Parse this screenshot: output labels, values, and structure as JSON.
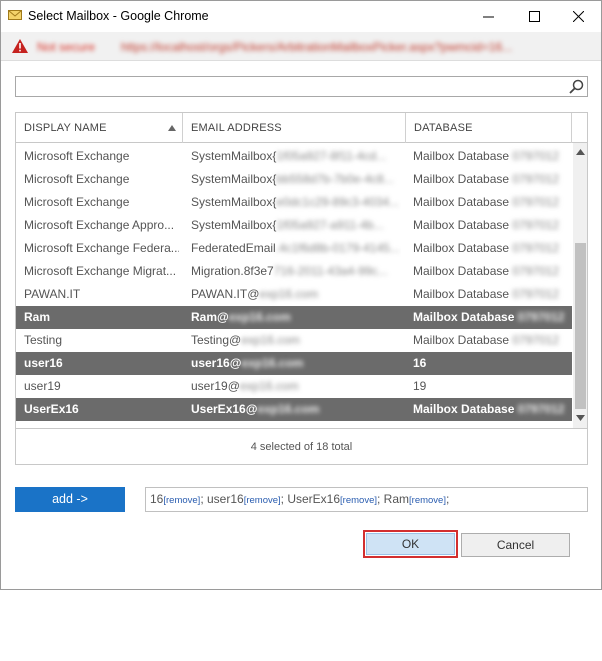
{
  "window": {
    "title": "Select Mailbox - Google Chrome"
  },
  "urlbar": {
    "security_label": "Not secure",
    "url": "https://localhost/orgs/Pickers/ArbitrationMailboxPicker.aspx?pwmcid=16..."
  },
  "search": {
    "value": "",
    "placeholder": ""
  },
  "table": {
    "columns": [
      "DISPLAY NAME",
      "EMAIL ADDRESS",
      "DATABASE"
    ],
    "rows": [
      {
        "name": "Microsoft Exchange",
        "email": "SystemMailbox{",
        "email_hidden": "1f05a927-8f11-4cd...",
        "db": "Mailbox Database ",
        "db_hidden": "0797012",
        "selected": false
      },
      {
        "name": "Microsoft Exchange",
        "email": "SystemMailbox{",
        "email_hidden": "bb558d7b-7b0e-4c8...",
        "db": "Mailbox Database ",
        "db_hidden": "0797012",
        "selected": false
      },
      {
        "name": "Microsoft Exchange",
        "email": "SystemMailbox{",
        "email_hidden": "e0dc1c29-89c3-4034...",
        "db": "Mailbox Database ",
        "db_hidden": "0797012",
        "selected": false
      },
      {
        "name": "Microsoft Exchange Appro...",
        "email": "SystemMailbox{",
        "email_hidden": "1f05a927-a911-4b...",
        "db": "Mailbox Database ",
        "db_hidden": "0797012",
        "selected": false
      },
      {
        "name": "Microsoft Exchange Federa...",
        "email": "FederatedEmail",
        "email_hidden": ".4c1f6d8b-0179-4145...",
        "db": "Mailbox Database ",
        "db_hidden": "0797012",
        "selected": false
      },
      {
        "name": "Microsoft Exchange Migrat...",
        "email": "Migration.8f3e7",
        "email_hidden": "716-2011-43a4-99c...",
        "db": "Mailbox Database ",
        "db_hidden": "0797012",
        "selected": false
      },
      {
        "name": "PAWAN.IT",
        "email": "PAWAN.IT@",
        "email_hidden": "exp16.com",
        "db": "Mailbox Database ",
        "db_hidden": "0797012",
        "selected": false
      },
      {
        "name": "Ram",
        "email": "Ram@",
        "email_hidden": "exp16.com",
        "db": "Mailbox Database ",
        "db_hidden": "0797012",
        "selected": true
      },
      {
        "name": "Testing",
        "email": "Testing@",
        "email_hidden": "exp16.com",
        "db": "Mailbox Database ",
        "db_hidden": "0797012",
        "selected": false
      },
      {
        "name": "user16",
        "email": "user16@",
        "email_hidden": "exp16.com",
        "db": "16",
        "db_hidden": "",
        "selected": true
      },
      {
        "name": "user19",
        "email": "user19@",
        "email_hidden": "exp16.com",
        "db": "19",
        "db_hidden": "",
        "selected": false
      },
      {
        "name": "UserEx16",
        "email": "UserEx16@",
        "email_hidden": "exp16.com",
        "db": "Mailbox Database ",
        "db_hidden": "0797012",
        "selected": true
      }
    ],
    "footer": "4 selected of 18 total"
  },
  "add_button": {
    "label": "add ->"
  },
  "selected_items": [
    {
      "name": "16",
      "remove": "[remove]",
      "sep": "; "
    },
    {
      "name": "user16",
      "remove": "[remove]",
      "sep": "; "
    },
    {
      "name": "UserEx16",
      "remove": "[remove]",
      "sep": "; "
    },
    {
      "name": "Ram",
      "remove": "[remove]",
      "sep": ";"
    }
  ],
  "buttons": {
    "ok": "OK",
    "cancel": "Cancel"
  },
  "colors": {
    "selected_row": "#6b6b6b",
    "add_button": "#1a73c7",
    "ok_highlight": "#d32f2f"
  }
}
